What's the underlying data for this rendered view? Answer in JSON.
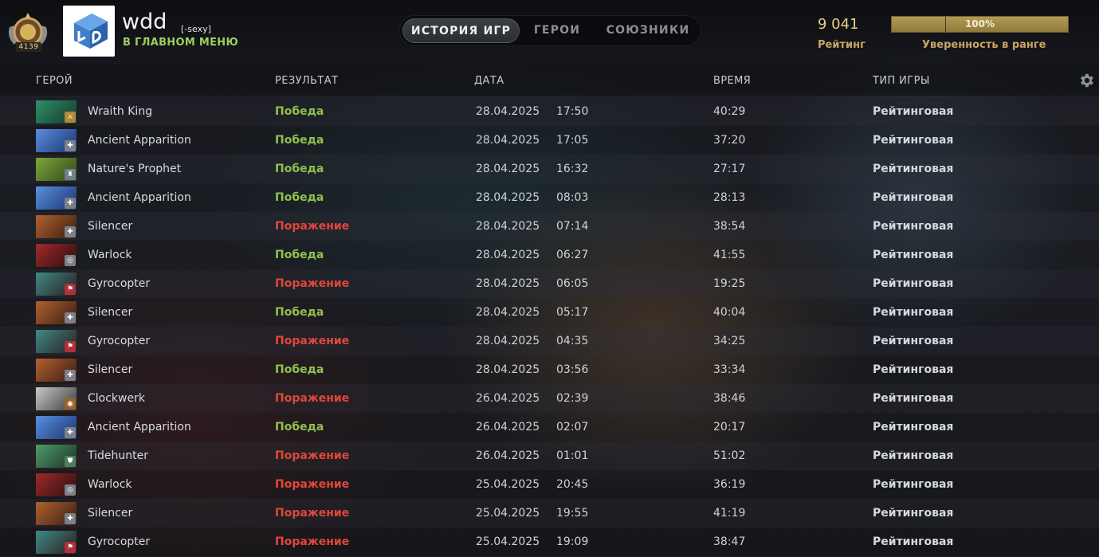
{
  "profile": {
    "rank_number": "4139",
    "name": "wdd",
    "tag": "[-sexy]",
    "status": "В ГЛАВНОМ МЕНЮ"
  },
  "tabs": [
    {
      "label": "ИСТОРИЯ ИГР",
      "active": true
    },
    {
      "label": "ГЕРОИ",
      "active": false
    },
    {
      "label": "СОЮЗНИКИ",
      "active": false
    }
  ],
  "rating": {
    "value": "9 041",
    "label": "Рейтинг"
  },
  "confidence": {
    "percent": 100,
    "text": "100%",
    "label": "Уверенность в ранге"
  },
  "columns": {
    "hero": "ГЕРОЙ",
    "result": "РЕЗУЛЬТАТ",
    "date": "ДАТА",
    "duration": "ВРЕМЯ",
    "mode": "ТИП ИГРЫ"
  },
  "colors": {
    "win": "#8fc14d",
    "loss": "#e0473a",
    "gold": "#c7a565"
  },
  "matches": [
    {
      "hero": "Wraith King",
      "hero_icon": "wraith-king-icon",
      "role_icon": "carry-icon",
      "result": "Победа",
      "win": true,
      "date": "28.04.2025",
      "time": "17:50",
      "duration": "40:29",
      "mode": "Рейтинговая"
    },
    {
      "hero": "Ancient Apparition",
      "hero_icon": "ancient-apparition-icon",
      "role_icon": "support-icon",
      "result": "Победа",
      "win": true,
      "date": "28.04.2025",
      "time": "17:05",
      "duration": "37:20",
      "mode": "Рейтинговая"
    },
    {
      "hero": "Nature's Prophet",
      "hero_icon": "natures-prophet-icon",
      "role_icon": "offlane-icon",
      "result": "Победа",
      "win": true,
      "date": "28.04.2025",
      "time": "16:32",
      "duration": "27:17",
      "mode": "Рейтинговая"
    },
    {
      "hero": "Ancient Apparition",
      "hero_icon": "ancient-apparition-icon",
      "role_icon": "support-icon",
      "result": "Победа",
      "win": true,
      "date": "28.04.2025",
      "time": "08:03",
      "duration": "28:13",
      "mode": "Рейтинговая"
    },
    {
      "hero": "Silencer",
      "hero_icon": "silencer-icon",
      "role_icon": "support-icon",
      "result": "Поражение",
      "win": false,
      "date": "28.04.2025",
      "time": "07:14",
      "duration": "38:54",
      "mode": "Рейтинговая"
    },
    {
      "hero": "Warlock",
      "hero_icon": "warlock-icon",
      "role_icon": "soft-support-icon",
      "result": "Победа",
      "win": true,
      "date": "28.04.2025",
      "time": "06:27",
      "duration": "41:55",
      "mode": "Рейтинговая"
    },
    {
      "hero": "Gyrocopter",
      "hero_icon": "gyrocopter-icon",
      "role_icon": "flag-icon",
      "result": "Поражение",
      "win": false,
      "date": "28.04.2025",
      "time": "06:05",
      "duration": "19:25",
      "mode": "Рейтинговая"
    },
    {
      "hero": "Silencer",
      "hero_icon": "silencer-icon",
      "role_icon": "support-icon",
      "result": "Победа",
      "win": true,
      "date": "28.04.2025",
      "time": "05:17",
      "duration": "40:04",
      "mode": "Рейтинговая"
    },
    {
      "hero": "Gyrocopter",
      "hero_icon": "gyrocopter-icon",
      "role_icon": "flag-icon",
      "result": "Поражение",
      "win": false,
      "date": "28.04.2025",
      "time": "04:35",
      "duration": "34:25",
      "mode": "Рейтинговая"
    },
    {
      "hero": "Silencer",
      "hero_icon": "silencer-icon",
      "role_icon": "support-icon",
      "result": "Победа",
      "win": true,
      "date": "28.04.2025",
      "time": "03:56",
      "duration": "33:34",
      "mode": "Рейтинговая"
    },
    {
      "hero": "Clockwerk",
      "hero_icon": "clockwerk-icon",
      "role_icon": "target-icon",
      "result": "Поражение",
      "win": false,
      "date": "26.04.2025",
      "time": "02:39",
      "duration": "38:46",
      "mode": "Рейтинговая"
    },
    {
      "hero": "Ancient Apparition",
      "hero_icon": "ancient-apparition-icon",
      "role_icon": "support-icon",
      "result": "Победа",
      "win": true,
      "date": "26.04.2025",
      "time": "02:07",
      "duration": "20:17",
      "mode": "Рейтинговая"
    },
    {
      "hero": "Tidehunter",
      "hero_icon": "tidehunter-icon",
      "role_icon": "shield-icon",
      "result": "Поражение",
      "win": false,
      "date": "26.04.2025",
      "time": "01:01",
      "duration": "51:02",
      "mode": "Рейтинговая"
    },
    {
      "hero": "Warlock",
      "hero_icon": "warlock-icon",
      "role_icon": "soft-support-icon",
      "result": "Поражение",
      "win": false,
      "date": "25.04.2025",
      "time": "20:45",
      "duration": "36:19",
      "mode": "Рейтинговая"
    },
    {
      "hero": "Silencer",
      "hero_icon": "silencer-icon",
      "role_icon": "support-icon",
      "result": "Поражение",
      "win": false,
      "date": "25.04.2025",
      "time": "19:55",
      "duration": "41:19",
      "mode": "Рейтинговая"
    },
    {
      "hero": "Gyrocopter",
      "hero_icon": "gyrocopter-icon",
      "role_icon": "flag-icon",
      "result": "Поражение",
      "win": false,
      "date": "25.04.2025",
      "time": "19:09",
      "duration": "38:47",
      "mode": "Рейтинговая"
    }
  ]
}
